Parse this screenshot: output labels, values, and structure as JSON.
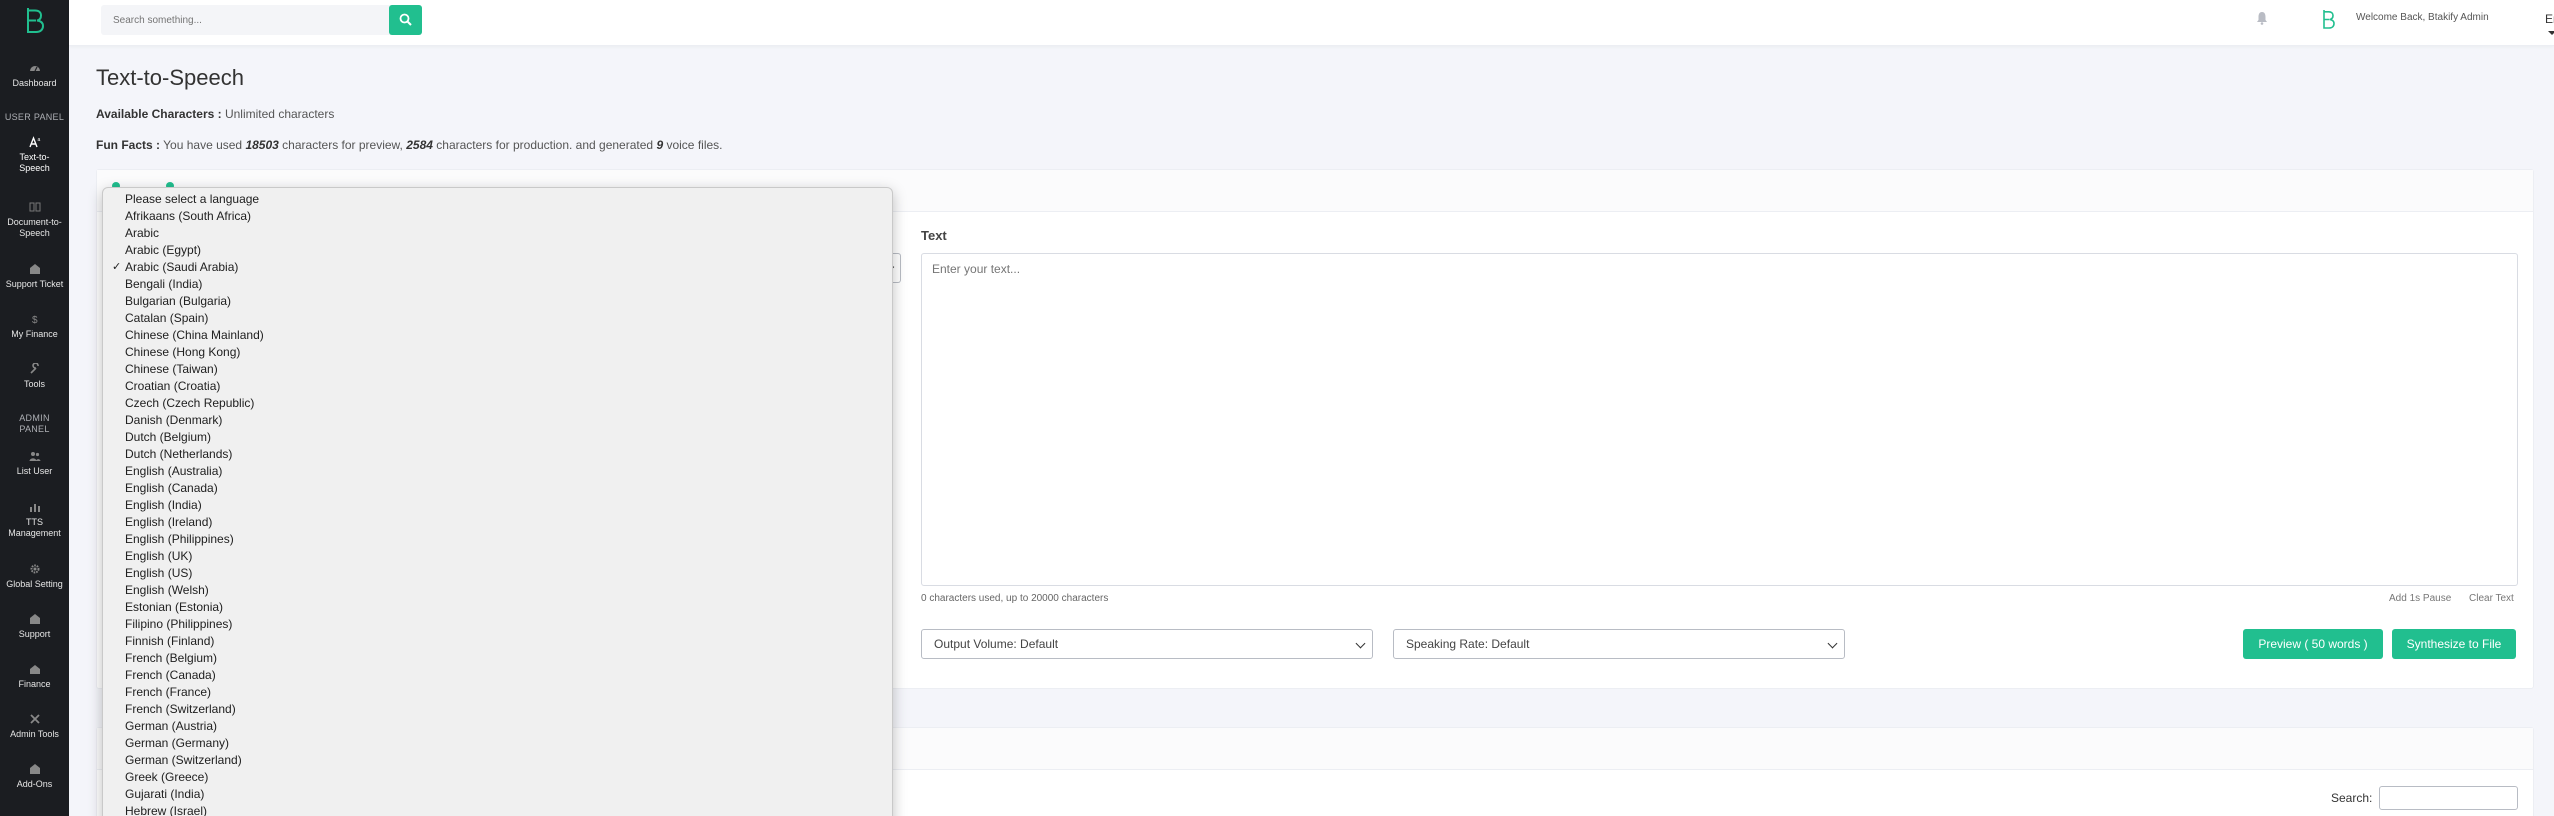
{
  "sidebar": {
    "items": [
      {
        "label": "Dashboard",
        "icon": "dashboard-icon"
      },
      {
        "label": "Text-to-Speech",
        "icon": "text-to-speech-icon"
      },
      {
        "label": "Document-to-Speech",
        "icon": "document-icon"
      },
      {
        "label": "Support Ticket",
        "icon": "ticket-icon"
      },
      {
        "label": "My Finance",
        "icon": "dollar-icon"
      },
      {
        "label": "Tools",
        "icon": "wrench-icon"
      },
      {
        "label": "List User",
        "icon": "users-icon"
      },
      {
        "label": "TTS Management",
        "icon": "tts-management-icon"
      },
      {
        "label": "Global Setting",
        "icon": "gear-icon"
      },
      {
        "label": "Support",
        "icon": "support-icon"
      },
      {
        "label": "Finance",
        "icon": "finance-icon"
      },
      {
        "label": "Admin Tools",
        "icon": "admin-tools-icon"
      },
      {
        "label": "Add-Ons",
        "icon": "addons-icon"
      }
    ],
    "user_panel_label": "USER PANEL",
    "admin_panel_label": "ADMIN PANEL"
  },
  "topbar": {
    "search_placeholder": "Search something...",
    "welcome_text": "Welcome Back, Btakify Admin",
    "language": "English"
  },
  "page": {
    "title": "Text-to-Speech",
    "available_label": "Available Characters :",
    "available_value": "Unlimited characters",
    "funfacts_label": "Fun Facts :",
    "funfacts_text_1": "You have used",
    "preview_chars": "18503",
    "funfacts_text_2": "characters for preview,",
    "production_chars": "2584",
    "funfacts_text_3": "characters for production. and generated",
    "voice_files": "9",
    "funfacts_text_4": "voice files."
  },
  "editor": {
    "text_label": "Text",
    "text_placeholder": "Enter your text...",
    "char_info": "0 characters used, up to 20000 characters",
    "add_pause": "Add 1s Pause",
    "clear_text": "Clear Text",
    "output_volume": "Output Volume: Default",
    "speaking_rate": "Speaking Rate: Default",
    "preview_button": "Preview ( 50 words )",
    "synthesize_button": "Synthesize to File"
  },
  "table": {
    "search_label": "Search:"
  },
  "language_dropdown": {
    "selected": "Arabic (Saudi Arabia)",
    "options": [
      "Please select a language",
      "Afrikaans (South Africa)",
      "Arabic",
      "Arabic (Egypt)",
      "Arabic (Saudi Arabia)",
      "Bengali (India)",
      "Bulgarian (Bulgaria)",
      "Catalan (Spain)",
      "Chinese (China Mainland)",
      "Chinese (Hong Kong)",
      "Chinese (Taiwan)",
      "Croatian (Croatia)",
      "Czech (Czech Republic)",
      "Danish (Denmark)",
      "Dutch (Belgium)",
      "Dutch (Netherlands)",
      "English (Australia)",
      "English (Canada)",
      "English (India)",
      "English (Ireland)",
      "English (Philippines)",
      "English (UK)",
      "English (US)",
      "English (Welsh)",
      "Estonian (Estonia)",
      "Filipino (Philippines)",
      "Finnish (Finland)",
      "French (Belgium)",
      "French (Canada)",
      "French (France)",
      "French (Switzerland)",
      "German (Austria)",
      "German (Germany)",
      "German (Switzerland)",
      "Greek (Greece)",
      "Gujarati (India)",
      "Hebrew (Israel)"
    ]
  },
  "colors": {
    "accent": "#21bf8f",
    "sidebar_bg": "#1b1d21",
    "page_bg": "#f4f5fa"
  }
}
